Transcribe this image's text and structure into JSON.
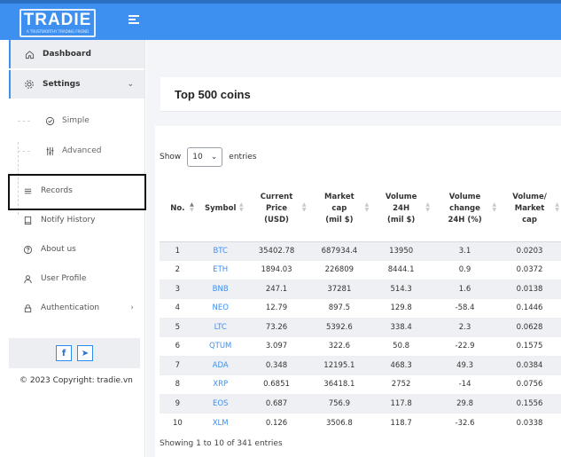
{
  "brand": {
    "name": "TRADIE",
    "tagline": "A TRUSTWORTHY TRADING FRIEND"
  },
  "sidebar": {
    "items": [
      {
        "label": "Dashboard",
        "icon": "home-icon"
      },
      {
        "label": "Settings",
        "icon": "gear-icon"
      },
      {
        "label": "Simple",
        "icon": "check-circle-icon"
      },
      {
        "label": "Advanced",
        "icon": "sliders-icon"
      },
      {
        "label": "Records",
        "icon": "list-icon"
      },
      {
        "label": "Notify History",
        "icon": "bookmark-icon"
      },
      {
        "label": "About us",
        "icon": "question-circle-icon"
      },
      {
        "label": "User Profile",
        "icon": "user-icon"
      },
      {
        "label": "Authentication",
        "icon": "lock-icon"
      }
    ],
    "social": {
      "facebook": "f",
      "telegram": "➤"
    },
    "copyright": "© 2023 Copyright: tradie.vn"
  },
  "main": {
    "title": "Top 500 coins",
    "show": {
      "before": "Show",
      "value": "10",
      "after": "entries"
    },
    "columns": [
      [
        "No."
      ],
      [
        "Symbol"
      ],
      [
        "Current",
        "Price",
        "(USD)"
      ],
      [
        "Market",
        "cap",
        "(mil $)"
      ],
      [
        "Volume",
        "24H",
        "(mil $)"
      ],
      [
        "Volume",
        "change",
        "24H (%)"
      ],
      [
        "Volume/",
        "Market",
        "cap"
      ]
    ],
    "rows": [
      [
        "1",
        "BTC",
        "35402.78",
        "687934.4",
        "13950",
        "3.1",
        "0.0203"
      ],
      [
        "2",
        "ETH",
        "1894.03",
        "226809",
        "8444.1",
        "0.9",
        "0.0372"
      ],
      [
        "3",
        "BNB",
        "247.1",
        "37281",
        "514.3",
        "1.6",
        "0.0138"
      ],
      [
        "4",
        "NEO",
        "12.79",
        "897.5",
        "129.8",
        "-58.4",
        "0.1446"
      ],
      [
        "5",
        "LTC",
        "73.26",
        "5392.6",
        "338.4",
        "2.3",
        "0.0628"
      ],
      [
        "6",
        "QTUM",
        "3.097",
        "322.6",
        "50.8",
        "-22.9",
        "0.1575"
      ],
      [
        "7",
        "ADA",
        "0.348",
        "12195.1",
        "468.3",
        "49.3",
        "0.0384"
      ],
      [
        "8",
        "XRP",
        "0.6851",
        "36418.1",
        "2752",
        "-14",
        "0.0756"
      ],
      [
        "9",
        "EOS",
        "0.687",
        "756.9",
        "117.8",
        "29.8",
        "0.1556"
      ],
      [
        "10",
        "XLM",
        "0.126",
        "3506.8",
        "118.7",
        "-32.6",
        "0.0338"
      ]
    ],
    "footer": "Showing 1 to 10 of 341 entries"
  },
  "colors": {
    "accent": "#3d8ff0",
    "sidebar_active": "#eceef2"
  }
}
